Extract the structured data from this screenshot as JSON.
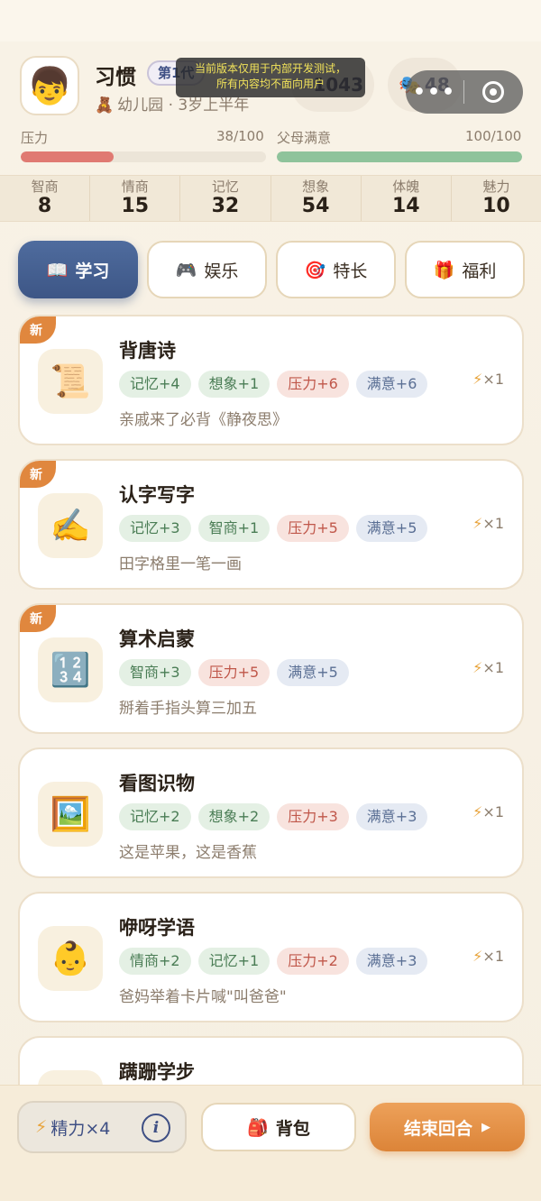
{
  "header": {
    "avatar_icon": "boy-face-icon",
    "avatar_glyph": "👦",
    "name": "习惯",
    "generation": "第1代",
    "stage_icon": "teddy-bear-icon",
    "stage_glyph": "🧸",
    "stage": "幼儿园 · 3岁上半年",
    "coins": "1043",
    "mask_glyph": "🎭",
    "masks": "48",
    "notice_line1": "当前版本仅用于内部开发测试，",
    "notice_line2": "所有内容均不面向用户",
    "capsule_dots": "•••"
  },
  "bars": {
    "pressure": {
      "label": "压力",
      "value_text": "38/100",
      "value": 38,
      "max": 100,
      "color": "#e07a72"
    },
    "satisfaction": {
      "label": "父母满意",
      "value_text": "100/100",
      "value": 100,
      "max": 100,
      "color": "#8fc39b"
    }
  },
  "stats": [
    {
      "label": "智商",
      "value": "8"
    },
    {
      "label": "情商",
      "value": "15"
    },
    {
      "label": "记忆",
      "value": "32"
    },
    {
      "label": "想象",
      "value": "54"
    },
    {
      "label": "体魄",
      "value": "14"
    },
    {
      "label": "魅力",
      "value": "10"
    }
  ],
  "tabs": [
    {
      "label": "学习",
      "icon": "book-icon",
      "glyph": "📖"
    },
    {
      "label": "娱乐",
      "icon": "gamepad-icon",
      "glyph": "🎮"
    },
    {
      "label": "特长",
      "icon": "target-icon",
      "glyph": "🎯"
    },
    {
      "label": "福利",
      "icon": "gift-icon",
      "glyph": "🎁"
    }
  ],
  "activities": [
    {
      "title": "背唐诗",
      "new": "新",
      "icon": "scroll-icon",
      "glyph": "📜",
      "tags": [
        {
          "text": "记忆+4",
          "kind": "green"
        },
        {
          "text": "想象+1",
          "kind": "green"
        },
        {
          "text": "压力+6",
          "kind": "red"
        },
        {
          "text": "满意+6",
          "kind": "blue"
        }
      ],
      "desc": "亲戚来了必背《静夜思》",
      "cost": "×1"
    },
    {
      "title": "认字写字",
      "new": "新",
      "icon": "writing-hand-icon",
      "glyph": "✍️",
      "tags": [
        {
          "text": "记忆+3",
          "kind": "green"
        },
        {
          "text": "智商+1",
          "kind": "green"
        },
        {
          "text": "压力+5",
          "kind": "red"
        },
        {
          "text": "满意+5",
          "kind": "blue"
        }
      ],
      "desc": "田字格里一笔一画",
      "cost": "×1"
    },
    {
      "title": "算术启蒙",
      "new": "新",
      "icon": "numbers-icon",
      "glyph": "🔢",
      "tags": [
        {
          "text": "智商+3",
          "kind": "green"
        },
        {
          "text": "压力+5",
          "kind": "red"
        },
        {
          "text": "满意+5",
          "kind": "blue"
        }
      ],
      "desc": "掰着手指头算三加五",
      "cost": "×1"
    },
    {
      "title": "看图识物",
      "new": "",
      "icon": "framed-picture-icon",
      "glyph": "🖼️",
      "tags": [
        {
          "text": "记忆+2",
          "kind": "green"
        },
        {
          "text": "想象+2",
          "kind": "green"
        },
        {
          "text": "压力+3",
          "kind": "red"
        },
        {
          "text": "满意+3",
          "kind": "blue"
        }
      ],
      "desc": "这是苹果，这是香蕉",
      "cost": "×1"
    },
    {
      "title": "咿呀学语",
      "new": "",
      "icon": "baby-icon",
      "glyph": "👶",
      "tags": [
        {
          "text": "情商+2",
          "kind": "green"
        },
        {
          "text": "记忆+1",
          "kind": "green"
        },
        {
          "text": "压力+2",
          "kind": "red"
        },
        {
          "text": "满意+3",
          "kind": "blue"
        }
      ],
      "desc": "爸妈举着卡片喊\"叫爸爸\"",
      "cost": "×1"
    },
    {
      "title": "蹒跚学步",
      "new": "",
      "icon": "chick-icon",
      "glyph": "🐥",
      "tags": [],
      "desc": "",
      "cost": ""
    }
  ],
  "bottom": {
    "energy_label": "精力×4",
    "info_glyph": "i",
    "bag_label": "背包",
    "bag_glyph": "🎒",
    "end_label": "结束回合",
    "end_arrow": "▶"
  }
}
